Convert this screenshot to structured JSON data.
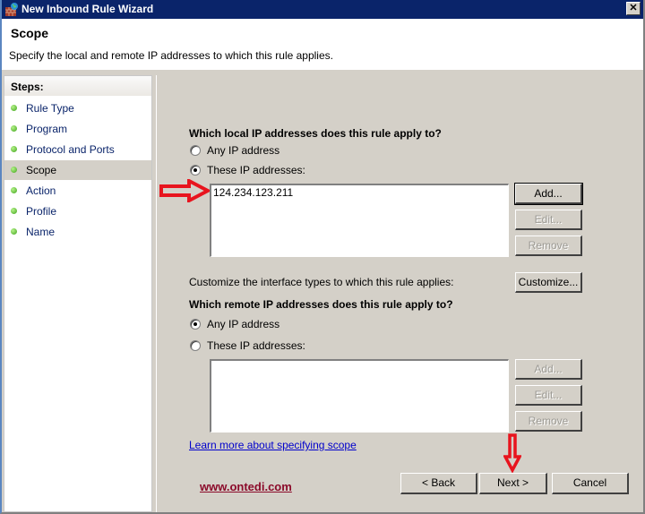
{
  "window": {
    "title": "New Inbound Rule Wizard",
    "close_icon": "close-icon"
  },
  "header": {
    "title": "Scope",
    "description": "Specify the local and remote IP addresses to which this rule applies."
  },
  "steps": {
    "heading": "Steps:",
    "items": [
      {
        "label": "Rule Type",
        "active": false
      },
      {
        "label": "Program",
        "active": false
      },
      {
        "label": "Protocol and Ports",
        "active": false
      },
      {
        "label": "Scope",
        "active": true
      },
      {
        "label": "Action",
        "active": false
      },
      {
        "label": "Profile",
        "active": false
      },
      {
        "label": "Name",
        "active": false
      }
    ]
  },
  "local": {
    "question": "Which local IP addresses does this rule apply to?",
    "option_any": "Any IP address",
    "option_these": "These IP addresses:",
    "selected": "these",
    "addresses": [
      "124.234.123.211"
    ],
    "add_label": "Add...",
    "edit_label": "Edit...",
    "remove_label": "Remove"
  },
  "customize": {
    "text": "Customize the interface types to which this rule applies:",
    "button_label": "Customize..."
  },
  "remote": {
    "question": "Which remote IP addresses does this rule apply to?",
    "option_any": "Any IP address",
    "option_these": "These IP addresses:",
    "selected": "any",
    "addresses": [],
    "add_label": "Add...",
    "edit_label": "Edit...",
    "remove_label": "Remove"
  },
  "learn_more": "Learn more about specifying scope",
  "watermark": "www.ontedi.com",
  "footer": {
    "back_label": "< Back",
    "next_label": "Next >",
    "cancel_label": "Cancel"
  },
  "annotation_color": "#e8141e"
}
